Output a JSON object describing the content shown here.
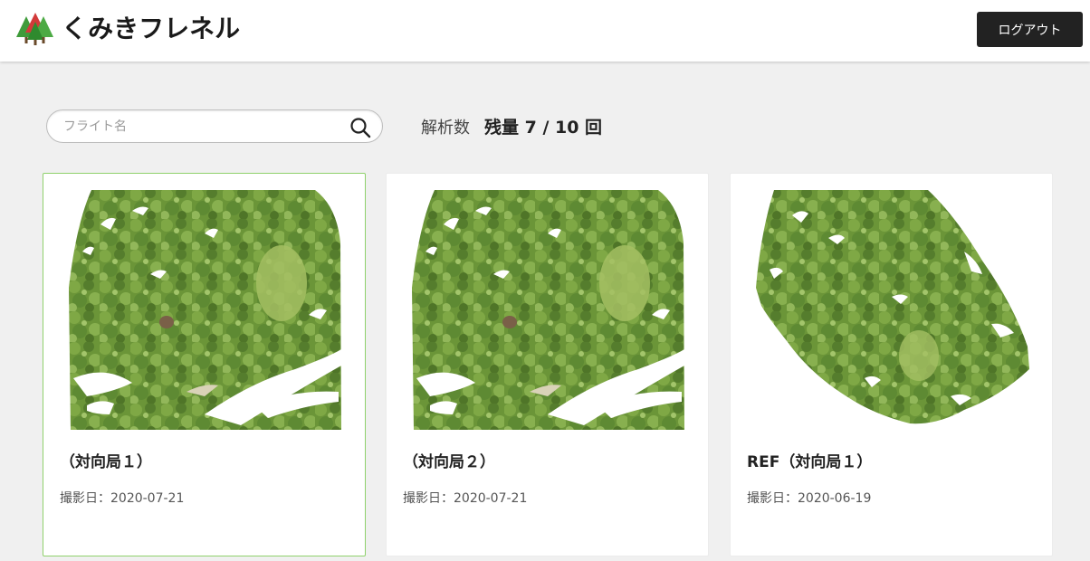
{
  "header": {
    "app_name": "くみきフレネル",
    "logout_label": "ログアウト"
  },
  "search": {
    "placeholder": "フライト名",
    "value": ""
  },
  "quota": {
    "label": "解析数",
    "value": "残量 7 / 10 回"
  },
  "flights": [
    {
      "title": "（対向局１）",
      "date": "撮影日：2020-07-21",
      "selected": true
    },
    {
      "title": "（対向局２）",
      "date": "撮影日：2020-07-21",
      "selected": false
    },
    {
      "title": "REF（対向局１）",
      "date": "撮影日：2020-06-19",
      "selected": false
    }
  ],
  "colors": {
    "brand_green": "#3f9b3a",
    "brand_red": "#d23a3a",
    "logout_bg": "#222222",
    "selected_border": "#8fd16c",
    "foliage": "#6f9a3c"
  },
  "icons": [
    "logo-trees-icon",
    "search-icon"
  ]
}
